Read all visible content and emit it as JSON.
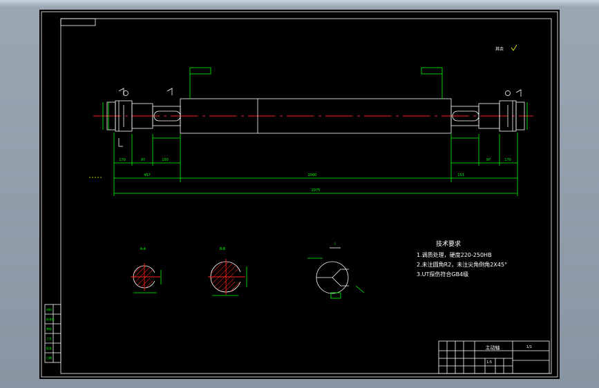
{
  "drawing": {
    "main_title_in_block": "主动轴",
    "roughness_note": "其余",
    "tech_requirements": {
      "heading": "技术要求",
      "items": [
        "1.调质处理，硬度220-250HB",
        "2.未注圆角R2，未注尖角倒角2X45°",
        "3.UT探伤符合GB4级"
      ]
    },
    "dimensions": {
      "overall_length": "2975",
      "middle_length": "2000",
      "left_sub": "457",
      "right_sub": "153",
      "d170": "170",
      "d150": "150",
      "d97": "97"
    },
    "section_labels": {
      "a": "A-A",
      "b": "B-B",
      "c": "I"
    },
    "title_block": {
      "sheet_no": "1/1",
      "ratio": "1:5"
    },
    "side_table": [
      "材料",
      "标准化",
      "审核",
      "工艺",
      "批准",
      "日期"
    ]
  },
  "colors": {
    "background": "#000000",
    "frame": "#00ff00",
    "part": "#ffffff",
    "axis": "#ff2020",
    "text": "#ffffff"
  }
}
